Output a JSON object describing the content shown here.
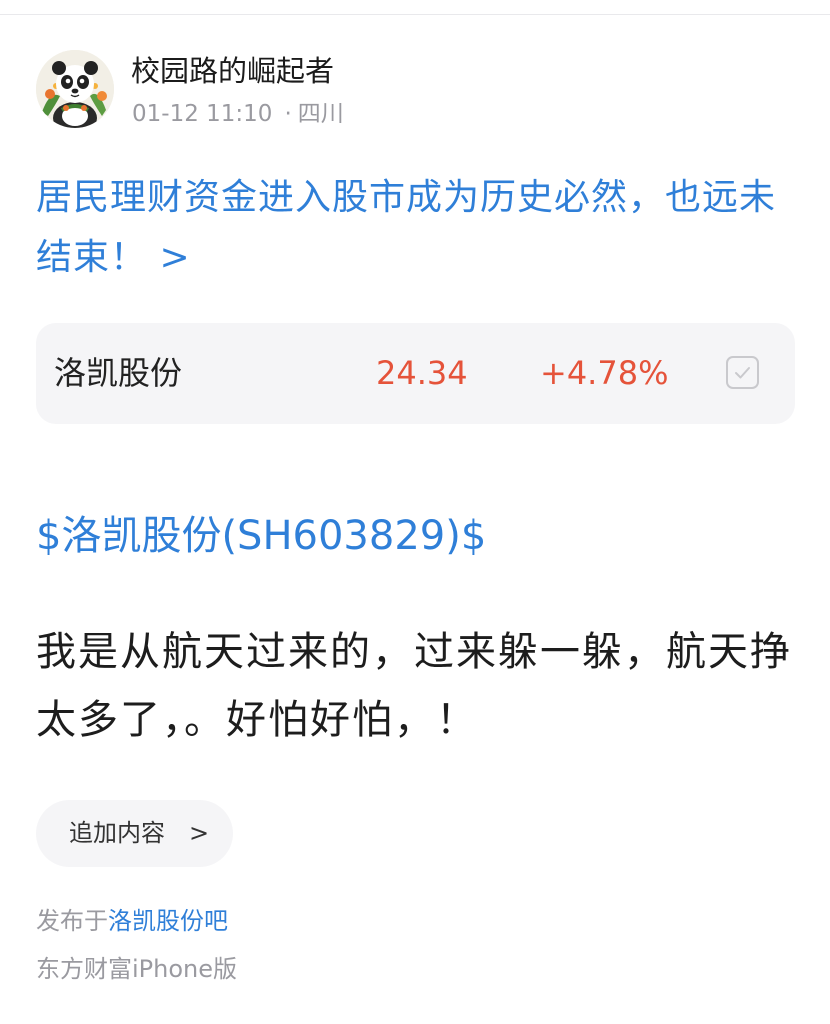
{
  "post": {
    "author": {
      "name": "校园路的崛起者",
      "avatar_icon": "panda-avatar-icon"
    },
    "date": "01-12 11:10",
    "separator": "·",
    "location": "四川",
    "headline": "居民理财资金进入股市成为历史必然，也远未结束！ >",
    "stock_card": {
      "name": "洛凯股份",
      "price": "24.34",
      "change": "+4.78%",
      "checkbox_icon": "checkbox-icon"
    },
    "stock_ref": "$洛凯股份(SH603829)$",
    "body": "我是从航天过来的，过来躲一躲，航天挣太多了，。好怕好怕，！",
    "add_content_button": {
      "label": "追加内容",
      "icon": ">"
    },
    "published_in_prefix": "发布于",
    "forum": "洛凯股份吧",
    "client": "东方财富iPhone版"
  },
  "colors": {
    "link": "#2f7fd8",
    "price_up": "#e5533a",
    "meta": "#9a9aa0",
    "card_bg": "#f5f5f7"
  }
}
